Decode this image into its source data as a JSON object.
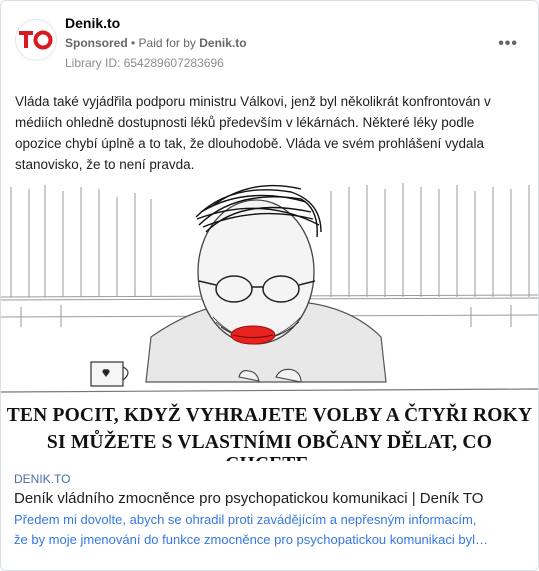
{
  "ad": {
    "page_name": "Denik.to",
    "sponsored_label": "Sponsored",
    "paid_for_prefix": "• Paid for by",
    "paid_for_by": "Denik.to",
    "library_id": "Library ID: 654289607283696",
    "more_icon": "ellipsis-icon",
    "logo_text": "TO",
    "brand_color": "#d71920"
  },
  "post": {
    "text": "Vláda také vyjádřila podporu ministru Válkovi, jenž byl několikrát konfrontován v médiích ohledně dostupnosti léků především v lékárnách. Některé léky podle opozice chybí úplně a to tak, že dlouhodobě. Vláda ve svém prohlášení vydala stanovisko, že to není pravda."
  },
  "image": {
    "caption_line1": "TEN POCIT, KDYŽ VYHRAJETE VOLBY A ČTYŘI ROKY",
    "caption_line2": "SI MŮŽETE S VLASTNÍMI OBČANY DĚLAT, CO CHCETE."
  },
  "link": {
    "domain": "DENIK.TO",
    "title": "Deník vládního zmocněnce pro psychopatickou komunikaci | Deník TO",
    "description_line1": "Předem mi dovolte, abych se ohradil proti zavádějícím a nepřesným informacím,",
    "description_line2": "že by moje jmenování do funkce zmocněnce pro psychopatickou komunikaci byl…"
  }
}
